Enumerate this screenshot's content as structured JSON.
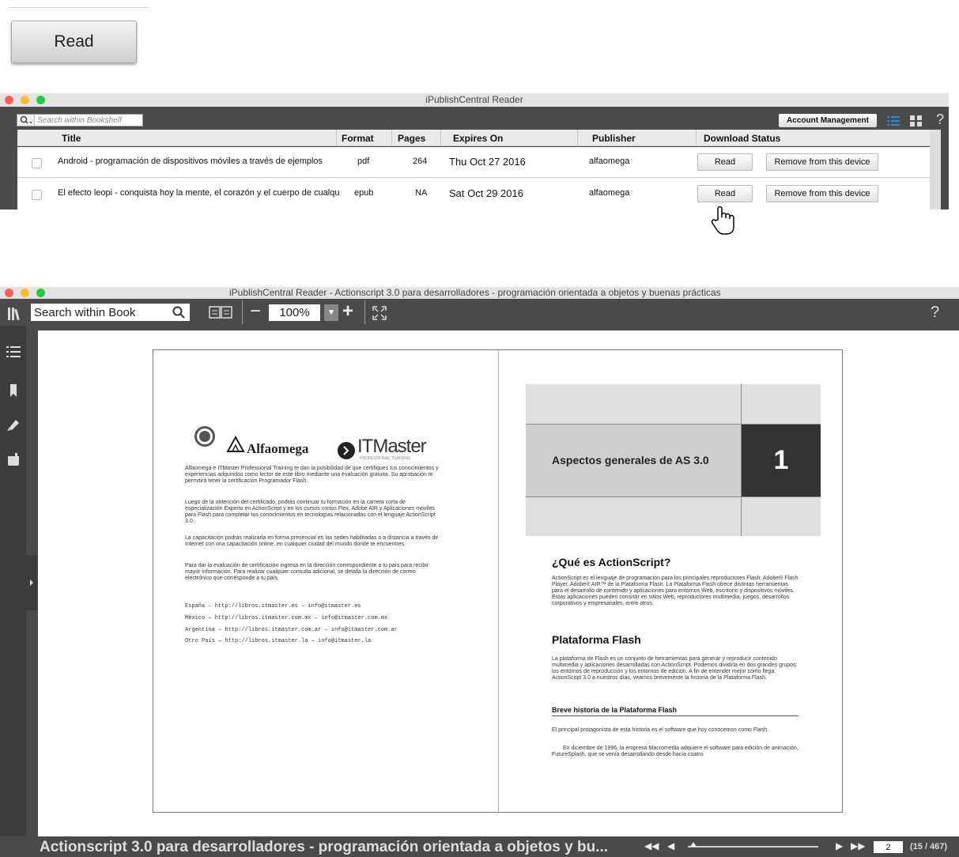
{
  "top_button": {
    "label": "Read"
  },
  "bookshelf": {
    "window_title": "iPublishCentral Reader",
    "search_placeholder": "Search within Bookshelf",
    "account_label": "Account Management",
    "help_label": "?",
    "columns": [
      "Title",
      "Format",
      "Pages",
      "Expires On",
      "Publisher",
      "Download Status"
    ],
    "rows": [
      {
        "title": "Android - programación de dispositivos móviles a través de ejemplos",
        "format": "pdf",
        "pages": "264",
        "expires": "Thu Oct 27 2016",
        "publisher": "alfaomega",
        "read": "Read",
        "remove": "Remove from this device"
      },
      {
        "title": "El efecto leopi - conquista hoy la mente, el corazón y el cuerpo de cualqu",
        "format": "epub",
        "pages": "NA",
        "expires": "Sat Oct 29 2016",
        "publisher": "alfaomega",
        "read": "Read",
        "remove": "Remove from this device"
      }
    ],
    "colors": {
      "toolbar": "#4a4a4a",
      "accent": "#2a8ae0"
    }
  },
  "reader": {
    "window_title": "iPublishCentral Reader -  Actionscript 3.0 para desarrolladores - programación orientada a objetos y buenas prácticas",
    "search_placeholder": "Search within Book",
    "zoom": "100%",
    "minus_label": "−",
    "plus_label": "+",
    "help_label": "?",
    "left_page": {
      "brand1": "Alfaomega",
      "brand2": "ITMaster",
      "brand2_sub": "PROFESSIONAL TRAINING",
      "paragraphs": [
        "Alfaomega e ITMaster Professional Training te dan la posibilidad de que certifiques tus conocimientos y experiencias adquiridos como lector de este libro mediante una evaluación gratuita. Su aprobación te permitirá tener la certificación Programador Flash.",
        "Luego de la obtención del certificado, podrás continuar tu formación en la carrera corta de especialización Experto en ActionScript y en los cursos cortos Flex, Adobe AIR y Aplicaciones móviles para Flash para completar tus conocimientos en tecnologías relacionadas con el lenguaje ActionScript 3.0.",
        "La capacitación podrás realizarla en forma presencial en las sedes habilitadas o a distancia a través de Internet con una capacitación online, en cualquier ciudad del mundo donde te encuentres.",
        "Para dar la evaluación de certificación ingresa en la dirección correspondiente a tu país para recibir mayor información. Para realizar cualquier consulta adicional, se detalla la dirección de correo electrónico que corresponde a tu país"
      ],
      "links": [
        "España – http://libros.itmaster.es – info@itmaster.es",
        "México – http://libros.itmaster.com.mx – info@itmaster.com.mx",
        "Argentina – http://libros.itmaster.com.ar – info@itmaster.com.ar",
        "Otro País – http://libros.itmaster.la – info@itmaster.la"
      ]
    },
    "right_page": {
      "chapter_title": "Aspectos generales de AS 3.0",
      "chapter_number": "1",
      "h1": "¿Qué es ActionScript?",
      "p1": "ActionScript es el lenguaje de programación para los principales reproductores Flash: Adobe® Flash Player, Adobe® AIR™ de la Plataforma Flash. La Plataforma Flash ofrece distintas herramientas para el desarrollo de contenido y aplicaciones para entornos Web, escritorio y dispositivos móviles. Estas aplicaciones pueden consistir en sitios Web, reproductores multimedia, juegos, desarrollos corporativos y empresariales, entre otros.",
      "h2": "Plataforma Flash",
      "p2": "La plataforma de Flash es un conjunto de herramientas para generar y reproducir contenido multimedia y aplicaciones desarrolladas con ActionScript. Podemos dividirla en dos grandes grupos: los entornos de reproducción y los entornos de edición. A fin de entender mejor cómo llega ActionScript 3.0 a nuestros días, veamos brevemente la historia de la Plataforma Flash.",
      "h3": "Breve historia de la Plataforma Flash",
      "p3": "El principal protagonista de esta historia es el software que hoy conocemos como Flash.",
      "p4": "En diciembre de 1996, la empresa Macromedia adquiere el software para edición de animación, FutureSplash, que se venía desarrollando desde hacía cuatro"
    },
    "book_title": "Actionscript 3.0 para desarrolladores - programación orientada a objetos y bu...",
    "page_input": "2",
    "page_count": "(15 / 467)",
    "progress": 0.03
  }
}
